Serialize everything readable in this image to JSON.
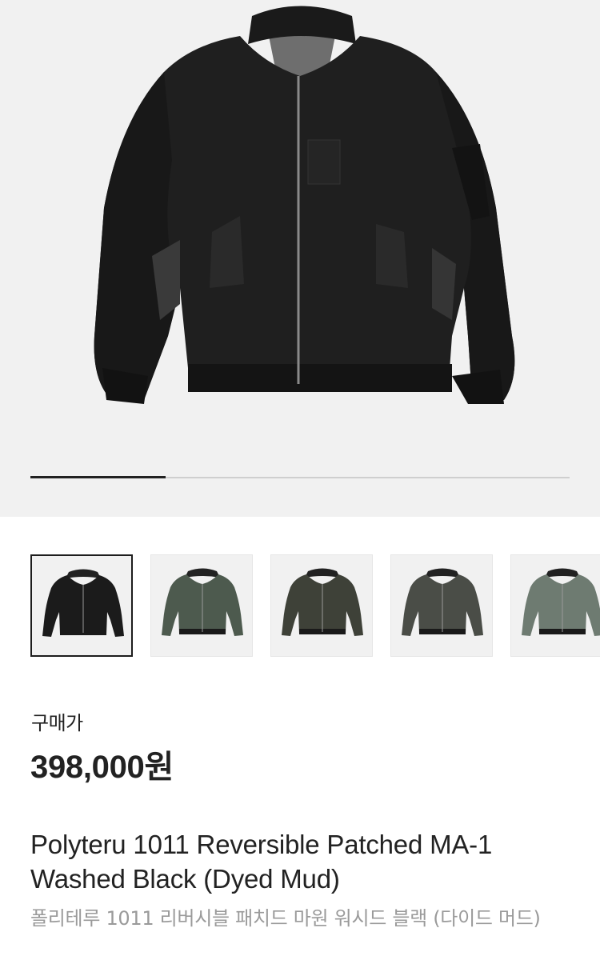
{
  "gallery": {
    "progress": 0.25,
    "thumbnails": [
      {
        "variant": "washed-black",
        "color": "#1b1b1b",
        "selected": true
      },
      {
        "variant": "dyed-mud-olive",
        "color": "#4d5a4e",
        "selected": false
      },
      {
        "variant": "dark-olive",
        "color": "#3e4138",
        "selected": false
      },
      {
        "variant": "charcoal-olive",
        "color": "#4a4d47",
        "selected": false
      },
      {
        "variant": "sage-gray",
        "color": "#6e7b71",
        "selected": false
      }
    ]
  },
  "product": {
    "price_label": "구매가",
    "price": "398,000원",
    "title": "Polyteru 1011 Reversible Patched MA-1 Washed Black (Dyed Mud)",
    "subtitle": "폴리테루 1011 리버시블 패치드 마원 워시드 블랙 (다이드 머드)"
  }
}
